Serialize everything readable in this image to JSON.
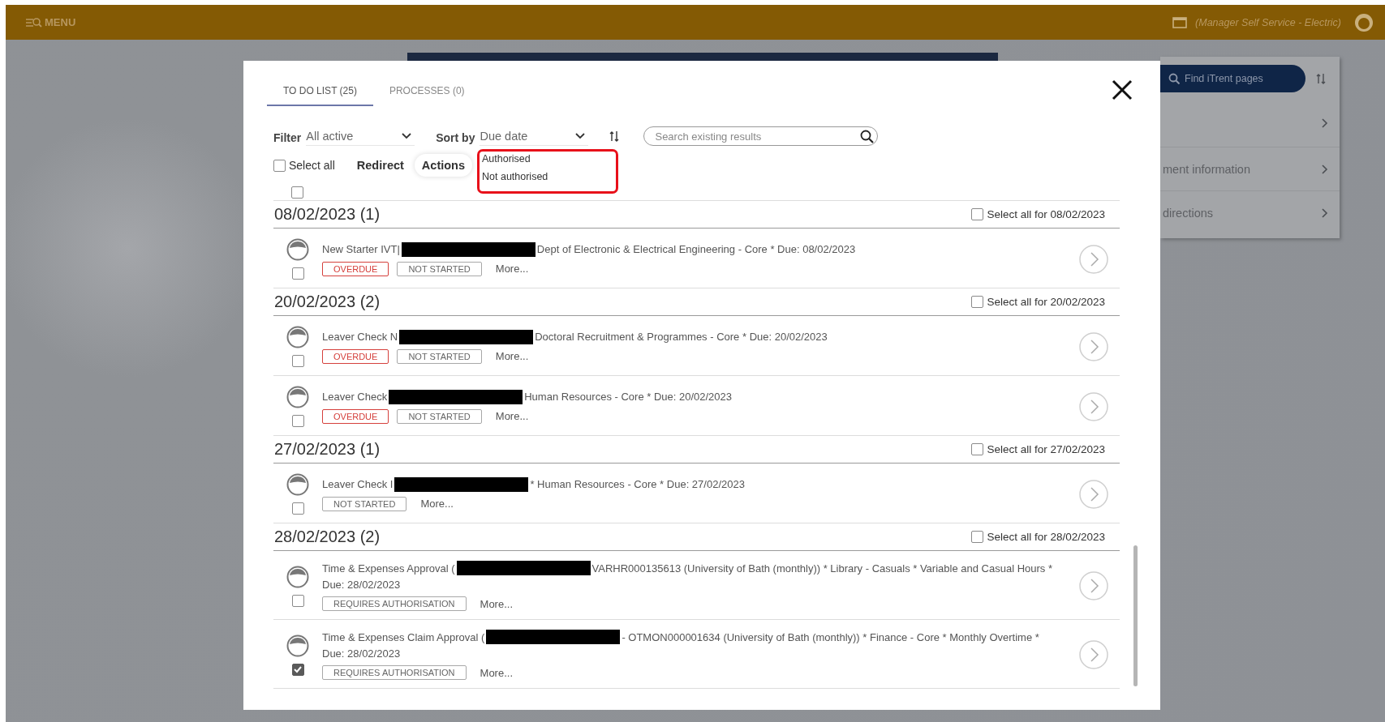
{
  "top_bar": {
    "menu_label": "MENU",
    "role": "(Manager Self Service - Electric)"
  },
  "background_panel": {
    "search_placeholder": "Find iTrent pages",
    "rows": [
      "ment information",
      "directions"
    ]
  },
  "modal": {
    "tabs": [
      {
        "label": "TO DO LIST (25)",
        "selected": true
      },
      {
        "label": "PROCESSES (0)",
        "selected": false
      }
    ],
    "filter": {
      "label": "Filter",
      "value": "All active"
    },
    "sort": {
      "label": "Sort by",
      "value": "Due date"
    },
    "search": {
      "placeholder": "Search existing results"
    },
    "select_all": {
      "label": "Select all",
      "checked": false
    },
    "actions": [
      "Redirect",
      "Actions"
    ],
    "actions_menu": [
      "Authorised",
      "Not authorised"
    ],
    "partial_row": {
      "checked": false
    },
    "groups": [
      {
        "date": "08/02/2023 (1)",
        "select_all_label": "Select all for 08/02/2023",
        "checked": false,
        "items": [
          {
            "title_start": "New Starter IVT|",
            "title_end": "Dept of Electronic & Electrical Engineering - Core * Due: 08/02/2023",
            "badges": [
              {
                "label": "OVERDUE",
                "kind": "overdue"
              },
              {
                "label": "NOT STARTED",
                "kind": "status"
              }
            ],
            "more": "More...",
            "checked": false
          }
        ]
      },
      {
        "date": "20/02/2023 (2)",
        "select_all_label": "Select all for 20/02/2023",
        "checked": false,
        "items": [
          {
            "title_start": "Leaver Check N",
            "title_end": "Doctoral Recruitment & Programmes - Core * Due: 20/02/2023",
            "badges": [
              {
                "label": "OVERDUE",
                "kind": "overdue"
              },
              {
                "label": "NOT STARTED",
                "kind": "status"
              }
            ],
            "more": "More...",
            "checked": false
          },
          {
            "title_start": "Leaver Check",
            "title_end": "Human Resources - Core * Due: 20/02/2023",
            "badges": [
              {
                "label": "OVERDUE",
                "kind": "overdue"
              },
              {
                "label": "NOT STARTED",
                "kind": "status"
              }
            ],
            "more": "More...",
            "checked": false
          }
        ]
      },
      {
        "date": "27/02/2023 (1)",
        "select_all_label": "Select all for 27/02/2023",
        "checked": false,
        "items": [
          {
            "title_start": "Leaver Check I",
            "title_end": "* Human Resources - Core * Due: 27/02/2023",
            "badges": [
              {
                "label": "NOT STARTED",
                "kind": "status"
              }
            ],
            "more": "More...",
            "checked": false
          }
        ]
      },
      {
        "date": "28/02/2023 (2)",
        "select_all_label": "Select all for 28/02/2023",
        "checked": false,
        "items": [
          {
            "title_start": "Time & Expenses Approval (",
            "title_end": "VARHR000135613 (University of Bath (monthly)) * Library - Casuals * Variable and Casual Hours *",
            "due_line": "Due: 28/02/2023",
            "badges": [
              {
                "label": "REQUIRES AUTHORISATION",
                "kind": "status"
              }
            ],
            "more": "More...",
            "checked": false
          },
          {
            "title_start": "Time & Expenses Claim Approval (",
            "title_end": "- OTMON000001634 (University of Bath (monthly)) * Finance - Core * Monthly Overtime *",
            "due_line": "Due: 28/02/2023",
            "badges": [
              {
                "label": "REQUIRES AUTHORISATION",
                "kind": "status"
              }
            ],
            "more": "More...",
            "checked": true
          }
        ]
      }
    ]
  }
}
